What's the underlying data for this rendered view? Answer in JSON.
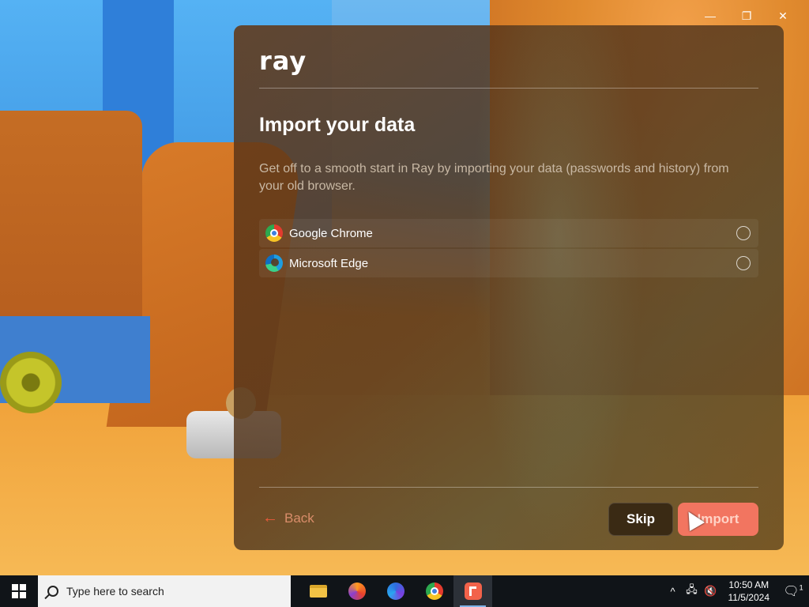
{
  "window": {
    "minimize_glyph": "—",
    "restore_glyph": "❐",
    "close_glyph": "✕"
  },
  "dialog": {
    "logo": "ray",
    "title": "Import your data",
    "subtitle": "Get off to a smooth start in Ray by importing your data (passwords and history) from your old browser.",
    "browsers": [
      {
        "label": "Google Chrome",
        "icon": "chrome-icon",
        "selected": false
      },
      {
        "label": "Microsoft Edge",
        "icon": "edge-icon",
        "selected": false
      }
    ],
    "back_label": "Back",
    "back_arrow": "←",
    "skip_label": "Skip",
    "import_label": "Import",
    "colors": {
      "accent": "#f27560",
      "back_text": "#d98d6a"
    }
  },
  "taskbar": {
    "search_placeholder": "Type here to search",
    "apps": [
      {
        "name": "file-explorer-icon",
        "active": false
      },
      {
        "name": "firefox-icon",
        "active": false
      },
      {
        "name": "firefox-nightly-icon",
        "active": false
      },
      {
        "name": "chrome-icon",
        "active": false
      },
      {
        "name": "ray-browser-icon",
        "active": true
      }
    ],
    "tray": {
      "chevron": "^",
      "time": "10:50 AM",
      "date": "11/5/2024",
      "notification_count": "1"
    }
  }
}
